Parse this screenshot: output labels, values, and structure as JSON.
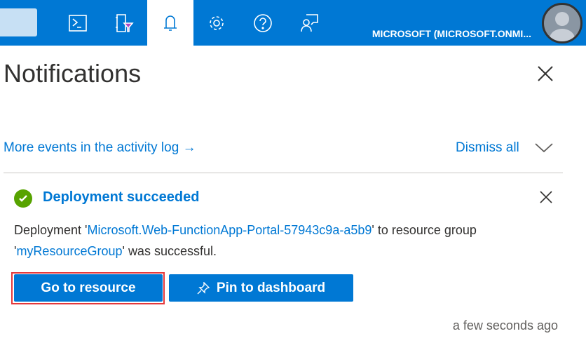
{
  "topbar": {
    "account": "MICROSOFT (MICROSOFT.ONMI...",
    "icons": [
      "cloud-shell-icon",
      "directory-filter-icon",
      "bell-icon",
      "gear-icon",
      "help-icon",
      "feedback-icon"
    ]
  },
  "panel": {
    "title": "Notifications",
    "activity_link": "More events in the activity log →",
    "dismiss_all": "Dismiss all"
  },
  "notification": {
    "title": "Deployment succeeded",
    "msg_prefix": "Deployment '",
    "deployment": "Microsoft.Web-FunctionApp-Portal-57943c9a-a5b9",
    "msg_mid": "' to resource group '",
    "group": "myResourceGroup",
    "msg_suffix": "' was successful.",
    "go_button": "Go to resource",
    "pin_button": "Pin to dashboard",
    "time": "a few seconds ago"
  },
  "colors": {
    "brand": "#0078d4",
    "success": "#57a300",
    "highlight": "#e5383b"
  }
}
